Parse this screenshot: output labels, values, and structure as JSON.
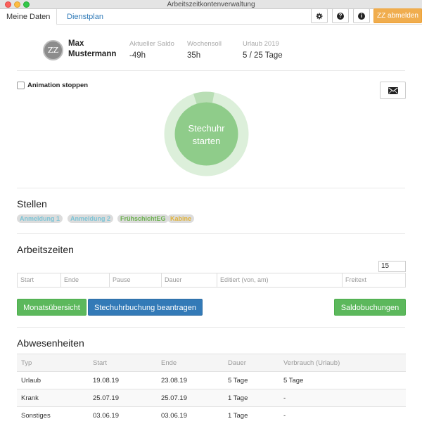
{
  "window": {
    "title": "Arbeitszeitkontenverwaltung"
  },
  "nav": {
    "tabs": [
      "Meine Daten",
      "Dienstplan"
    ],
    "icons": [
      "gear-icon",
      "question-icon",
      "info-icon"
    ],
    "logout_label": "ZZ abmelden",
    "accent_color": "#f0ad4e"
  },
  "profile": {
    "initials": "ZZ",
    "name": "Max Mustermann",
    "stats": [
      {
        "label": "Aktueller Saldo",
        "value": "-49h"
      },
      {
        "label": "Wochensoll",
        "value": "35h"
      },
      {
        "label": "Urlaub 2019",
        "value": "5 / 25 Tage"
      }
    ]
  },
  "controls": {
    "animation_label": "Animation stoppen",
    "animation_checked": false,
    "mail_icon": "envelope-icon"
  },
  "stechuhr": {
    "label": "Stechuhr\nstarten",
    "ring_progress": 0.1,
    "color": "#8fcc8a"
  },
  "stellen": {
    "title": "Stellen",
    "items": [
      {
        "label": "Anmeldung 1",
        "color": "#7dc4d6"
      },
      {
        "label": "Anmeldung 2",
        "color": "#7dc4d6"
      },
      {
        "label": "FrühschichtEG",
        "color": "#6ab04c"
      },
      {
        "label": "Kabine",
        "color": "#e0b23a"
      }
    ]
  },
  "arbeitszeiten": {
    "title": "Arbeitszeiten",
    "page_size": "15",
    "columns": [
      "Start",
      "Ende",
      "Pause",
      "Dauer",
      "Editiert (von, am)",
      "Freitext"
    ]
  },
  "buttons": {
    "monatsuebersicht": "Monatsübersicht",
    "stechuhrbuchung": "Stechuhrbuchung beantragen",
    "saldobuchungen": "Saldobuchungen"
  },
  "abwesenheiten": {
    "title": "Abwesenheiten",
    "columns": [
      "Typ",
      "Start",
      "Ende",
      "Dauer",
      "Verbrauch (Urlaub)"
    ],
    "rows": [
      [
        "Urlaub",
        "19.08.19",
        "23.08.19",
        "5 Tage",
        "5 Tage"
      ],
      [
        "Krank",
        "25.07.19",
        "25.07.19",
        "1 Tage",
        "-"
      ],
      [
        "Sonstiges",
        "03.06.19",
        "03.06.19",
        "1 Tage",
        "-"
      ]
    ]
  }
}
